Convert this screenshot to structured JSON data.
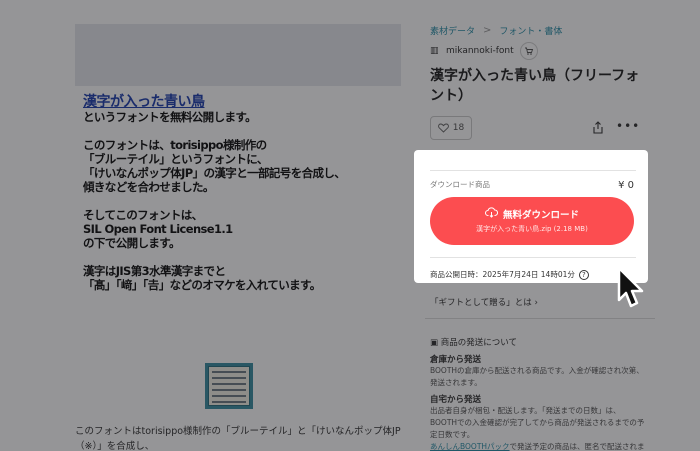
{
  "preview": {
    "title": "漢字が入った青い鳥",
    "lines": [
      "というフォントを無料公開します。",
      "",
      "このフォントは、torisippo様制作の",
      "「ブルーテイル」というフォントに、",
      "「けいなんポップ体JP」の漢字と一部記号を合成し、",
      "傾きなどを合わせました。",
      "",
      "そしてこのフォントは、",
      "SIL Open Font License1.1",
      "の下で公開します。",
      "",
      "漢字はJIS第3水準漢字までと",
      "「髙」「﨑」「𠮷」などのオマケを入れています。"
    ]
  },
  "description": {
    "line1": "このフォントはtorisippo様制作の「ブルーテイル」と「けいなんポップ体JP",
    "line2": "（※）」を合成し、"
  },
  "breadcrumb": {
    "item1": "素材データ",
    "separator": ">",
    "item2": "フォント・書体"
  },
  "shop": {
    "name": "mikannoki-font",
    "icon": "shop-icon",
    "cart_icon": "cart-icon"
  },
  "product": {
    "title": "漢字が入った青い鳥（フリーフォント）",
    "likes": "18"
  },
  "card": {
    "item_label": "ダウンロード商品",
    "price": "¥ 0",
    "download_label": "無料ダウンロード",
    "file_name": "漢字が入った青い鳥.zip (2.18 MB)",
    "published": "商品公開日時：2025年7月24日 14時01分"
  },
  "gift": {
    "label": "「ギフトとして贈る」とは ›"
  },
  "shipping": {
    "heading": "商品の発送について",
    "warehouse_title": "倉庫から発送",
    "warehouse_text1": "BOOTHの倉庫から配送される商品です。入金が確認され次第、",
    "warehouse_text2": "発送されます。",
    "home_title": "自宅から発送",
    "home_text1": "出品者自身が梱包・配送します。「発送までの日数」は、",
    "home_text2": "BOOTHでの入金確認が完了してから商品が発送されるまでの予",
    "home_text3": "定日数です。",
    "home_link": "あんしんBOOTHパック",
    "home_text4": "で発送予定の商品は、匿名で配送されま"
  },
  "colors": {
    "accent": "#fc4d50",
    "link": "#2b8fa8",
    "preview_title": "#2040b0"
  }
}
